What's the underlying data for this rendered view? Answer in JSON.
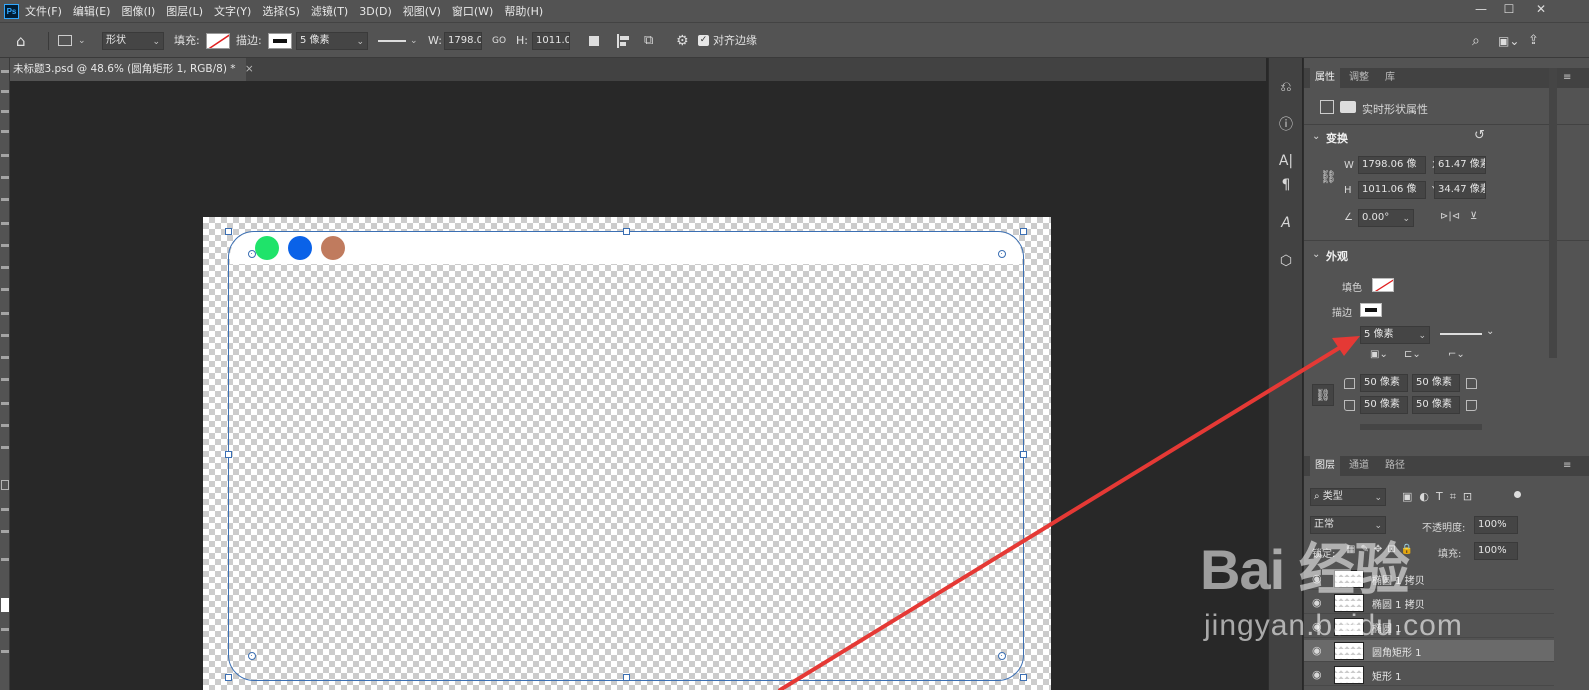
{
  "menubar": {
    "logo": "Ps",
    "items": [
      "文件(F)",
      "编辑(E)",
      "图像(I)",
      "图层(L)",
      "文字(Y)",
      "选择(S)",
      "滤镜(T)",
      "3D(D)",
      "视图(V)",
      "窗口(W)",
      "帮助(H)"
    ]
  },
  "options": {
    "mode": "形状",
    "fill_label": "填充:",
    "stroke_label": "描边:",
    "stroke_width": "5 像素",
    "w_label": "W:",
    "w_value": "1798.0",
    "link_label": "GO",
    "h_label": "H:",
    "h_value": "1011.0",
    "align_edges": "对齐边缘"
  },
  "document": {
    "tab_title": "未标题3.psd @ 48.6% (圆角矩形 1, RGB/8) *",
    "close": "×",
    "dot_colors": [
      "#1fe36a",
      "#0a62e8",
      "#c07b5e"
    ]
  },
  "properties": {
    "tabs": [
      "属性",
      "调整",
      "库"
    ],
    "shape_props": "实时形状属性",
    "transform_title": "变换",
    "w_label": "W",
    "w_value": "1798.06 像",
    "x_label": "X",
    "x_value": "61.47 像素",
    "h_label": "H",
    "h_value": "1011.06 像",
    "y_label": "Y",
    "y_value": "34.47 像素",
    "angle_value": "0.00°",
    "appearance_title": "外观",
    "fill_label": "填色",
    "stroke_label": "描边",
    "stroke_width": "5 像素",
    "radius": [
      "50 像素",
      "50 像素",
      "50 像素",
      "50 像素"
    ]
  },
  "layers": {
    "tabs": [
      "图层",
      "通道",
      "路径"
    ],
    "filter": "类型",
    "blend": "正常",
    "opacity_label": "不透明度:",
    "opacity_value": "100%",
    "lock_label": "锁定:",
    "fill_label": "填充:",
    "fill_value": "100%",
    "items": [
      "椭圆 1 拷贝",
      "椭圆 1 拷贝",
      "椭圆 1",
      "圆角矩形 1",
      "矩形 1"
    ]
  },
  "watermark": {
    "line1": "Bai 经验",
    "line2": "jingyan.baidu.com"
  },
  "colors": {
    "accent_arrow": "#e53935",
    "selection": "#3b6fb3"
  }
}
